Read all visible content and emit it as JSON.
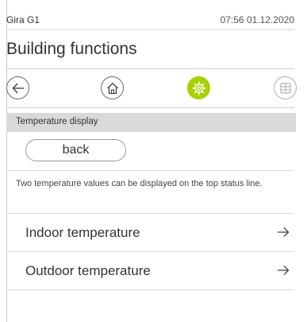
{
  "status": {
    "device": "Gira G1",
    "datetime": "07:56 01.12.2020"
  },
  "page": {
    "title": "Building functions"
  },
  "iconbar": {
    "items": [
      {
        "icon": "back-arrow-icon",
        "state": "normal"
      },
      {
        "icon": "home-icon",
        "state": "normal"
      },
      {
        "icon": "settings-gear-icon",
        "state": "active"
      },
      {
        "icon": "grid-icon",
        "state": "disabled"
      }
    ],
    "accent": "#a7d000"
  },
  "section": {
    "label": "Temperature display"
  },
  "back_button": {
    "label": "back"
  },
  "description": "Two temperature values can be displayed on the top status line.",
  "rows": [
    {
      "label": "Indoor temperature",
      "icon": "arrow-right-icon"
    },
    {
      "label": "Outdoor temperature",
      "icon": "arrow-right-icon"
    }
  ]
}
